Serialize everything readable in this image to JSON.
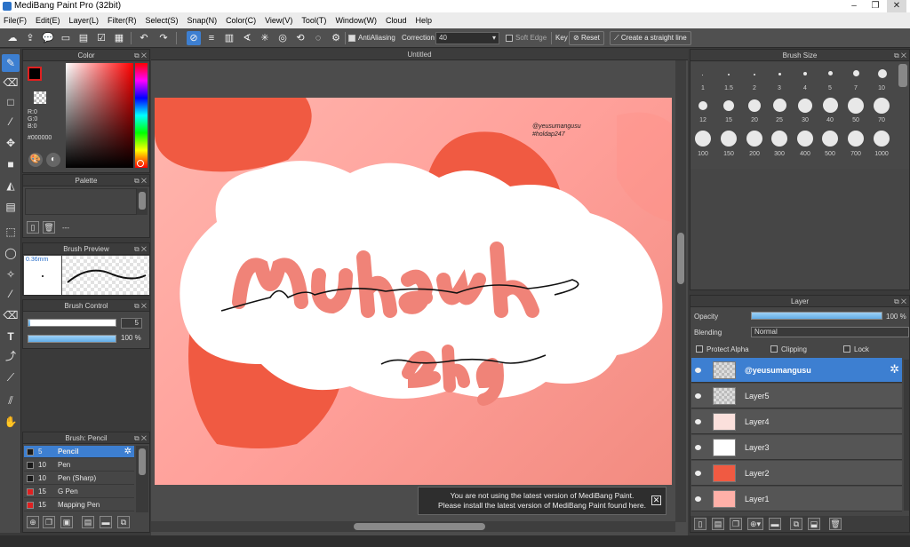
{
  "window": {
    "title": "MediBang Paint Pro (32bit)",
    "controls": [
      "–",
      "❐",
      "✕"
    ]
  },
  "menu": [
    "File(F)",
    "Edit(E)",
    "Layer(L)",
    "Filter(R)",
    "Select(S)",
    "Snap(N)",
    "Color(C)",
    "View(V)",
    "Tool(T)",
    "Window(W)",
    "Cloud",
    "Help"
  ],
  "toolbar": {
    "antialiasing_label": "AntiAliasing",
    "correction_label": "Correction",
    "correction_value": "40",
    "soft_edge_label": "Soft Edge",
    "key_label": "Key",
    "reset_label": "Reset",
    "straight_line_label": "Create a straight line"
  },
  "color_panel": {
    "title": "Color",
    "r_label": "R:0",
    "g_label": "G:0",
    "b_label": "B:0",
    "hex": "#000000",
    "primary_color": "#000000"
  },
  "palette_panel": {
    "title": "Palette",
    "footer": "---"
  },
  "brush_preview": {
    "title": "Brush Preview",
    "size_label": "0.36mm"
  },
  "brush_control": {
    "title": "Brush Control",
    "size_value": "5",
    "opacity_value": "100 %"
  },
  "brush_list": {
    "title": "Brush: Pencil",
    "items": [
      {
        "num": "5",
        "name": "Pencil",
        "color": "#1a1a1a"
      },
      {
        "num": "10",
        "name": "Pen",
        "color": "#1a1a1a"
      },
      {
        "num": "10",
        "name": "Pen (Sharp)",
        "color": "#1a1a1a"
      },
      {
        "num": "15",
        "name": "G Pen",
        "color": "#e02020"
      },
      {
        "num": "15",
        "name": "Mapping Pen",
        "color": "#e02020"
      }
    ]
  },
  "document": {
    "tab_title": "Untitled"
  },
  "artwork": {
    "watermark_line1": "@yeusumangusu",
    "watermark_line2": "#holdap247"
  },
  "brush_size": {
    "title": "Brush Size",
    "sizes": [
      "1",
      "1.5",
      "2",
      "3",
      "4",
      "5",
      "7",
      "10",
      "12",
      "15",
      "20",
      "25",
      "30",
      "40",
      "50",
      "70",
      "100",
      "150",
      "200",
      "300",
      "400",
      "500",
      "700",
      "1000"
    ]
  },
  "layer_panel": {
    "title": "Layer",
    "opacity_label": "Opacity",
    "opacity_value": "100 %",
    "blending_label": "Blending",
    "blending_value": "Normal",
    "protect_alpha_label": "Protect Alpha",
    "clipping_label": "Clipping",
    "lock_label": "Lock",
    "layers": [
      {
        "name": "@yeusumangusu",
        "selected": true
      },
      {
        "name": "Layer5",
        "selected": false
      },
      {
        "name": "Layer4",
        "selected": false
      },
      {
        "name": "Layer3",
        "selected": false
      },
      {
        "name": "Layer2",
        "selected": false
      },
      {
        "name": "Layer1",
        "selected": false
      }
    ]
  },
  "notice": {
    "line1": "You are not using the latest version of MediBang Paint.",
    "line2": "Please install the latest version of MediBang Paint found here."
  }
}
